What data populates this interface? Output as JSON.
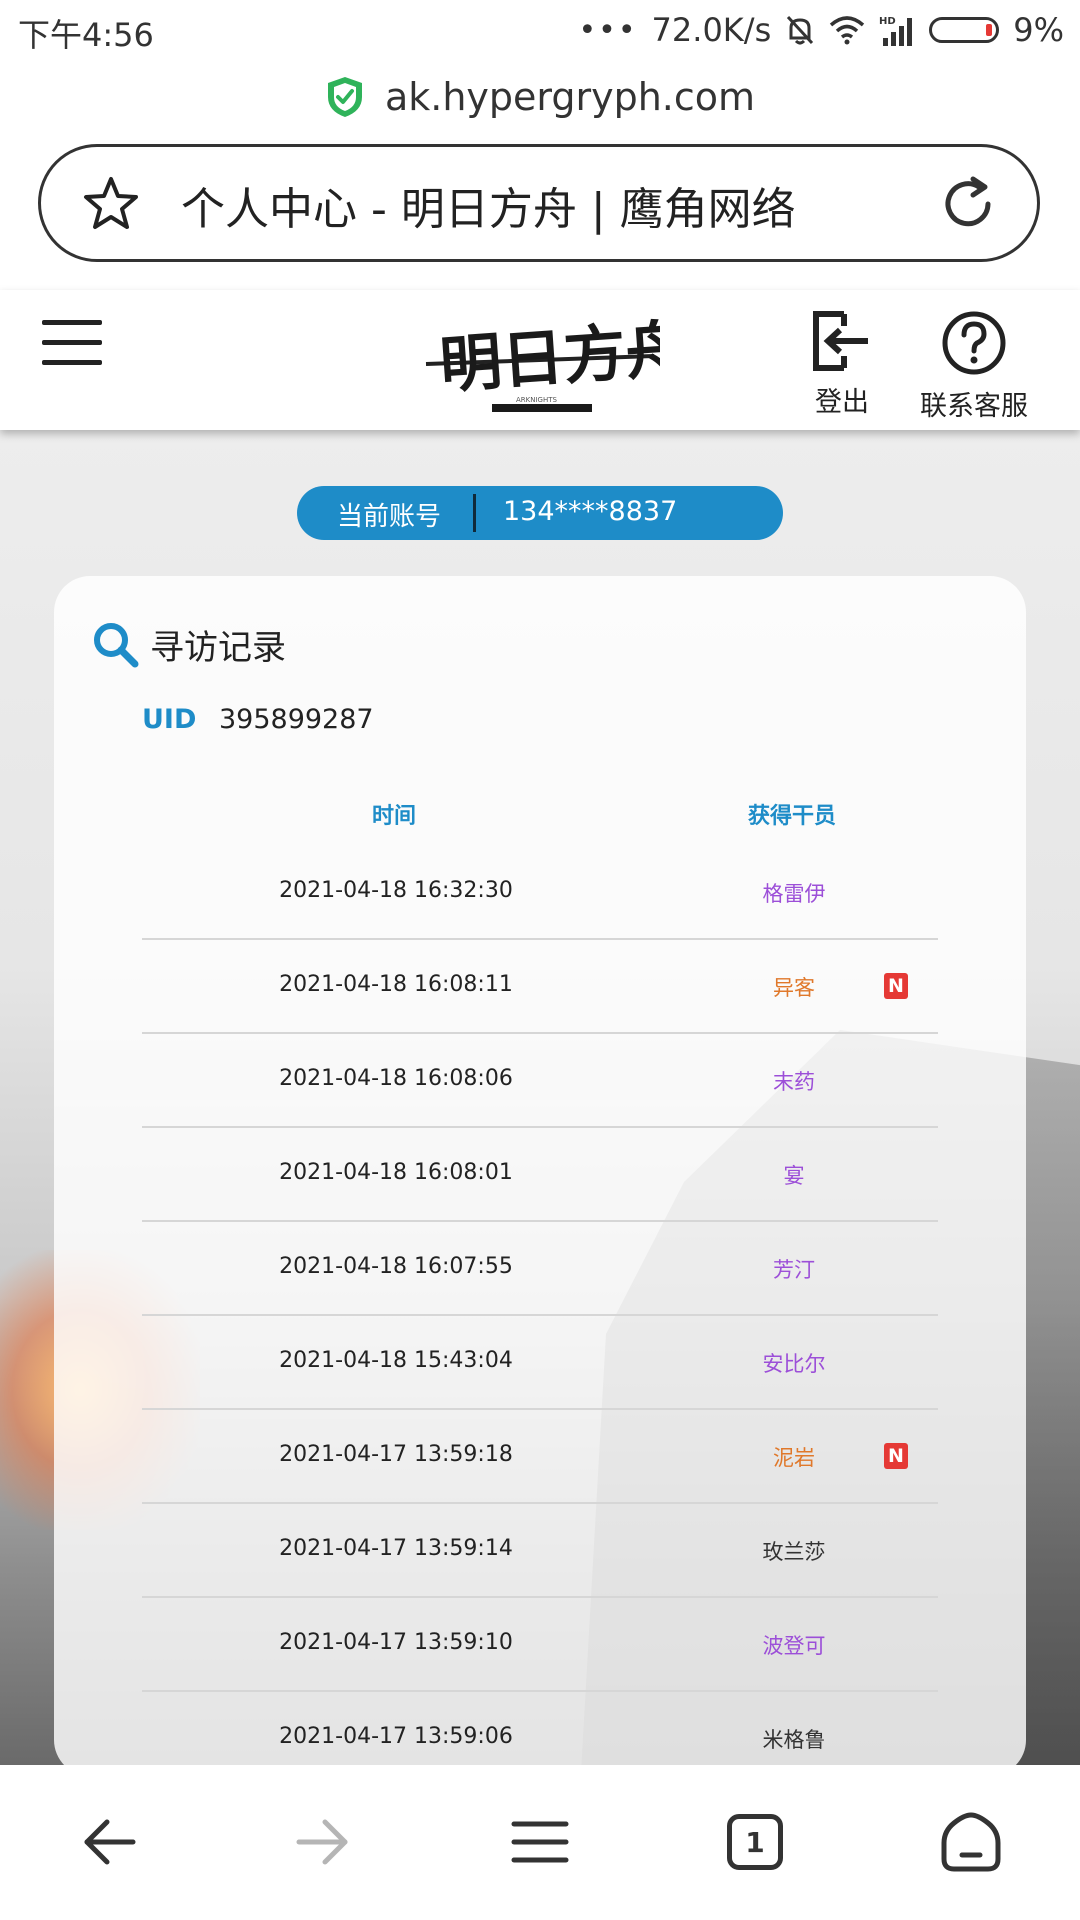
{
  "status_bar": {
    "time": "下午4:56",
    "dots": "•••",
    "speed": "72.0K/s",
    "battery": "9%",
    "icons": [
      "mute-icon",
      "wifi-icon",
      "hd-signal-icon",
      "battery-icon"
    ]
  },
  "browser": {
    "url": "ak.hypergryph.com",
    "page_title": "个人中心 - 明日方舟 | 鹰角网络"
  },
  "header": {
    "logo_text": "明日方舟",
    "logo_sub": "ARKNIGHTS",
    "logout_label": "登出",
    "support_label": "联系客服"
  },
  "account": {
    "label": "当前账号",
    "value": "134****8837"
  },
  "card": {
    "title": "寻访记录",
    "uid_label": "UID",
    "uid_value": "395899287",
    "col_time": "时间",
    "col_operator": "获得干员",
    "records": [
      {
        "time": "2021-04-18 16:32:30",
        "operator": "格雷伊",
        "color": "#9c4fd8",
        "new": false
      },
      {
        "time": "2021-04-18 16:08:11",
        "operator": "异客",
        "color": "#e0782a",
        "new": true
      },
      {
        "time": "2021-04-18 16:08:06",
        "operator": "末药",
        "color": "#9c4fd8",
        "new": false
      },
      {
        "time": "2021-04-18 16:08:01",
        "operator": "宴",
        "color": "#9c4fd8",
        "new": false
      },
      {
        "time": "2021-04-18 16:07:55",
        "operator": "芳汀",
        "color": "#9c4fd8",
        "new": false
      },
      {
        "time": "2021-04-18 15:43:04",
        "operator": "安比尔",
        "color": "#9c4fd8",
        "new": false
      },
      {
        "time": "2021-04-17 13:59:18",
        "operator": "泥岩",
        "color": "#e0782a",
        "new": true
      },
      {
        "time": "2021-04-17 13:59:14",
        "operator": "玫兰莎",
        "color": "#333333",
        "new": false
      },
      {
        "time": "2021-04-17 13:59:10",
        "operator": "波登可",
        "color": "#9c4fd8",
        "new": false
      },
      {
        "time": "2021-04-17 13:59:06",
        "operator": "米格鲁",
        "color": "#333333",
        "new": false
      }
    ],
    "new_badge": "N"
  },
  "bottom_nav": {
    "tab_count": "1"
  }
}
